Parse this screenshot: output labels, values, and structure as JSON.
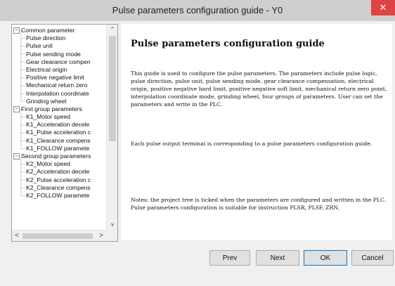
{
  "window": {
    "title": "Pulse parameters configuration guide - Y0",
    "close_glyph": "✕"
  },
  "tree": {
    "expanded_glyph": "−",
    "items": [
      {
        "label": "Common parameter",
        "level": 0,
        "expandable": true
      },
      {
        "label": "Pulse direction",
        "level": 1
      },
      {
        "label": "Pulse unit",
        "level": 1
      },
      {
        "label": "Pulse sending mode",
        "level": 1
      },
      {
        "label": "Gear clearance compen",
        "level": 1
      },
      {
        "label": "Electrical origin",
        "level": 1
      },
      {
        "label": "Positive negative limit",
        "level": 1
      },
      {
        "label": "Mechanical return zero",
        "level": 1
      },
      {
        "label": "Interpolation coordinate",
        "level": 1
      },
      {
        "label": "Grinding wheel",
        "level": 1
      },
      {
        "label": "First group parameters",
        "level": 0,
        "expandable": true
      },
      {
        "label": "K1_Motor speed",
        "level": 1
      },
      {
        "label": "K1_Acceleration decele",
        "level": 1
      },
      {
        "label": "K1_Pulse acceleration c",
        "level": 1
      },
      {
        "label": "K1_Clearance compens",
        "level": 1
      },
      {
        "label": "K1_FOLLOW paramete",
        "level": 1
      },
      {
        "label": "Second group parameters",
        "level": 0,
        "expandable": true
      },
      {
        "label": "K2_Motor speed",
        "level": 1
      },
      {
        "label": "K2_Acceleration decele",
        "level": 1
      },
      {
        "label": "K2_Pulse acceleration c",
        "level": 1
      },
      {
        "label": "K2_Clearance compens",
        "level": 1
      },
      {
        "label": "K2_FOLLOW paramete",
        "level": 1
      }
    ],
    "scroll_up_glyph": "^",
    "scroll_down_glyph": "v",
    "scroll_left_glyph": "<",
    "scroll_right_glyph": ">"
  },
  "content": {
    "heading": "Pulse parameters configuration guide",
    "paragraphs": [
      "This guide is used to configure the pulse parameters. The parameters include pulse logic, pulse direction, pulse unit, pulse sending mode, gear clearance compensation, electrical origin, positive negative hard limit, positive negative soft limit, mechanical return zero point, interpolation coordinate mode, grinding wheel, four groups of parameters. User can set the parameters and write in the PLC.",
      "Each pulse output terminal is corresponding to a pulse parameters configuration guide.",
      "Notes: the project tree is ticked when the parameters are configured and written in the PLC.  Pulse parameters configuration is suitable for instruction PLSR, PLSF, ZRN."
    ]
  },
  "buttons": {
    "prev": "Prev",
    "next": "Next",
    "ok": "OK",
    "cancel": "Cancel"
  }
}
